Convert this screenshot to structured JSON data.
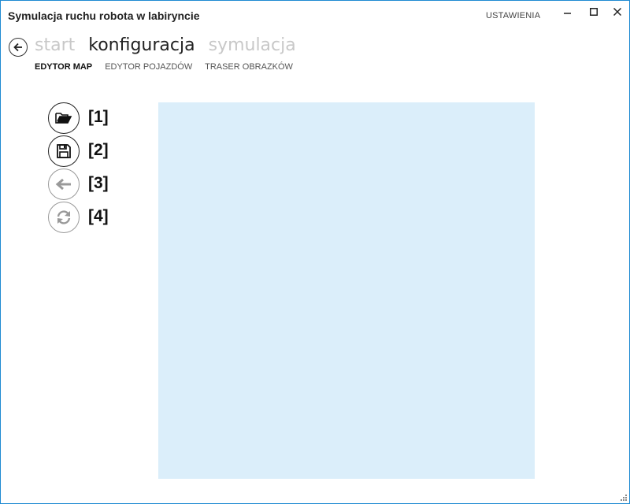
{
  "window": {
    "title": "Symulacja ruchu robota w labiryncie",
    "settings_label": "USTAWIENIA",
    "controls": [
      "minimize-icon",
      "maximize-icon",
      "close-icon"
    ]
  },
  "navigation": {
    "back_icon": "arrow-left-icon",
    "tabs": [
      {
        "label": "start",
        "active": false
      },
      {
        "label": "konfiguracja",
        "active": true
      },
      {
        "label": "symulacja",
        "active": false
      }
    ],
    "sub_tabs": [
      {
        "label": "EDYTOR MAP",
        "active": true
      },
      {
        "label": "EDYTOR POJAZDÓW",
        "active": false
      },
      {
        "label": "TRASER OBRAZKÓW",
        "active": false
      }
    ]
  },
  "toolbar": {
    "buttons": [
      {
        "icon": "open-folder-icon",
        "label": "[1]",
        "enabled": true
      },
      {
        "icon": "save-icon",
        "label": "[2]",
        "enabled": true
      },
      {
        "icon": "undo-arrow-icon",
        "label": "[3]",
        "enabled": false
      },
      {
        "icon": "refresh-icon",
        "label": "[4]",
        "enabled": false
      }
    ]
  },
  "map": {
    "background_color": "#dbeefa"
  },
  "colors": {
    "accent_border": "#1f8ad2",
    "inactive_text": "#c8c8c8"
  }
}
